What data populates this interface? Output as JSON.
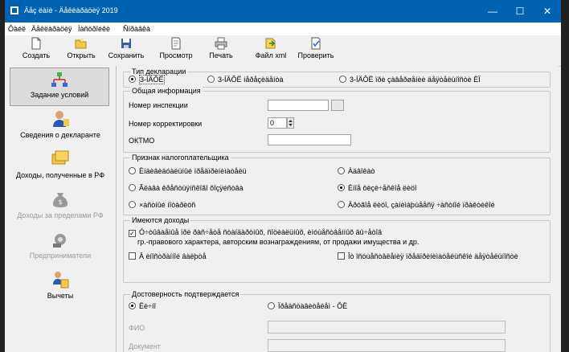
{
  "titlebar": {
    "title": "Äåç ëàìè - Äåêëàðàöèÿ 2019",
    "minimize": "—",
    "maximize": "☐",
    "close": "✕"
  },
  "menu": [
    "Ôàéë",
    "Äåêëàðàöèÿ",
    "Íàñòðîéêè",
    "Ñïðàâêà"
  ],
  "toolbar": [
    {
      "label": "Создать",
      "icon": "new-file-icon"
    },
    {
      "label": "Открыть",
      "icon": "open-folder-icon"
    },
    {
      "label": "Сохранить",
      "icon": "save-disk-icon"
    },
    {
      "label": "Просмотр",
      "icon": "preview-page-icon"
    },
    {
      "label": "Печать",
      "icon": "printer-icon"
    },
    {
      "label": "Файл xml",
      "icon": "xml-export-icon"
    },
    {
      "label": "Проверить",
      "icon": "check-document-icon"
    }
  ],
  "sidebar": [
    {
      "label": "Задание условий",
      "icon": "conditions-icon",
      "state": "active"
    },
    {
      "label": "Сведения о декларанте",
      "icon": "person-icon",
      "state": "normal"
    },
    {
      "label": "Доходы, полученные в РФ",
      "icon": "coins-icon",
      "state": "normal"
    },
    {
      "label": "Доходы за пределами РФ",
      "icon": "money-bag-icon",
      "state": "disabled"
    },
    {
      "label": "Предприниматели",
      "icon": "entrepreneur-icon",
      "state": "disabled"
    },
    {
      "label": "Вычеты",
      "icon": "deductions-icon",
      "state": "normal"
    }
  ],
  "decl_type": {
    "caption": "Тип декларации",
    "options": [
      "3-ÍÄÔË",
      "3-ÍÄÔË íåðåçèäåíòà",
      "3-ÍÄÔË ïðè çàâåðøåíèè äåÿòåëüíîñòè ÈÏ"
    ],
    "selected": 0
  },
  "general": {
    "caption": "Общая информация",
    "inspection_label": "Номер инспекции",
    "inspection_value": "",
    "correction_label": "Номер корректировки",
    "correction_value": "0",
    "oktmo_label": "ОКТМО",
    "oktmo_value": ""
  },
  "taxpayer": {
    "caption": "Признак налогоплательщика",
    "options": [
      "Èíäèâèäóàëüíûé ïðåäïðèíèìàòåëü",
      "Àäâîêàò",
      "Ãëàâà êðåñòüÿíñêîãî õîçÿéñòâà",
      "Èíîå ôèçè÷åñêîå ëèöî",
      "×àñòíûé íîòàðèóñ",
      "Äðóãîå ëèöî, çàíèìàþùååñÿ ÷àñòíîé ïðàêòèêîé"
    ],
    "selected": 3
  },
  "incomes": {
    "caption": "Имеются доходы",
    "opt1_line1": "Ó÷òûâàåìûå ïðè ðàñ÷åòå ñòàíäàðòíûõ, ñîöèàëüíûõ, èìóùåñòâåííûõ âû÷åòîâ",
    "opt1_line2": "гр.-правового характера, авторским вознаграждениям, от продажи имущества и др.",
    "opt1_checked": true,
    "opt2": "Â èíîñòðàííîé âàëþòå",
    "opt2_checked": false,
    "opt3": "Îò îñóùåñòâëåíèÿ ïðåäïðèíèìàòåëüñêîé äåÿòåëüíîñòè",
    "opt3_checked": false
  },
  "reliability": {
    "caption": "Достоверность подтверждается",
    "options": [
      "Ëè÷íî",
      "Ïðåäñòàâèòåëåì - ÔË"
    ],
    "selected": 0,
    "fio_label": "ФИО",
    "doc_label": "Документ"
  }
}
